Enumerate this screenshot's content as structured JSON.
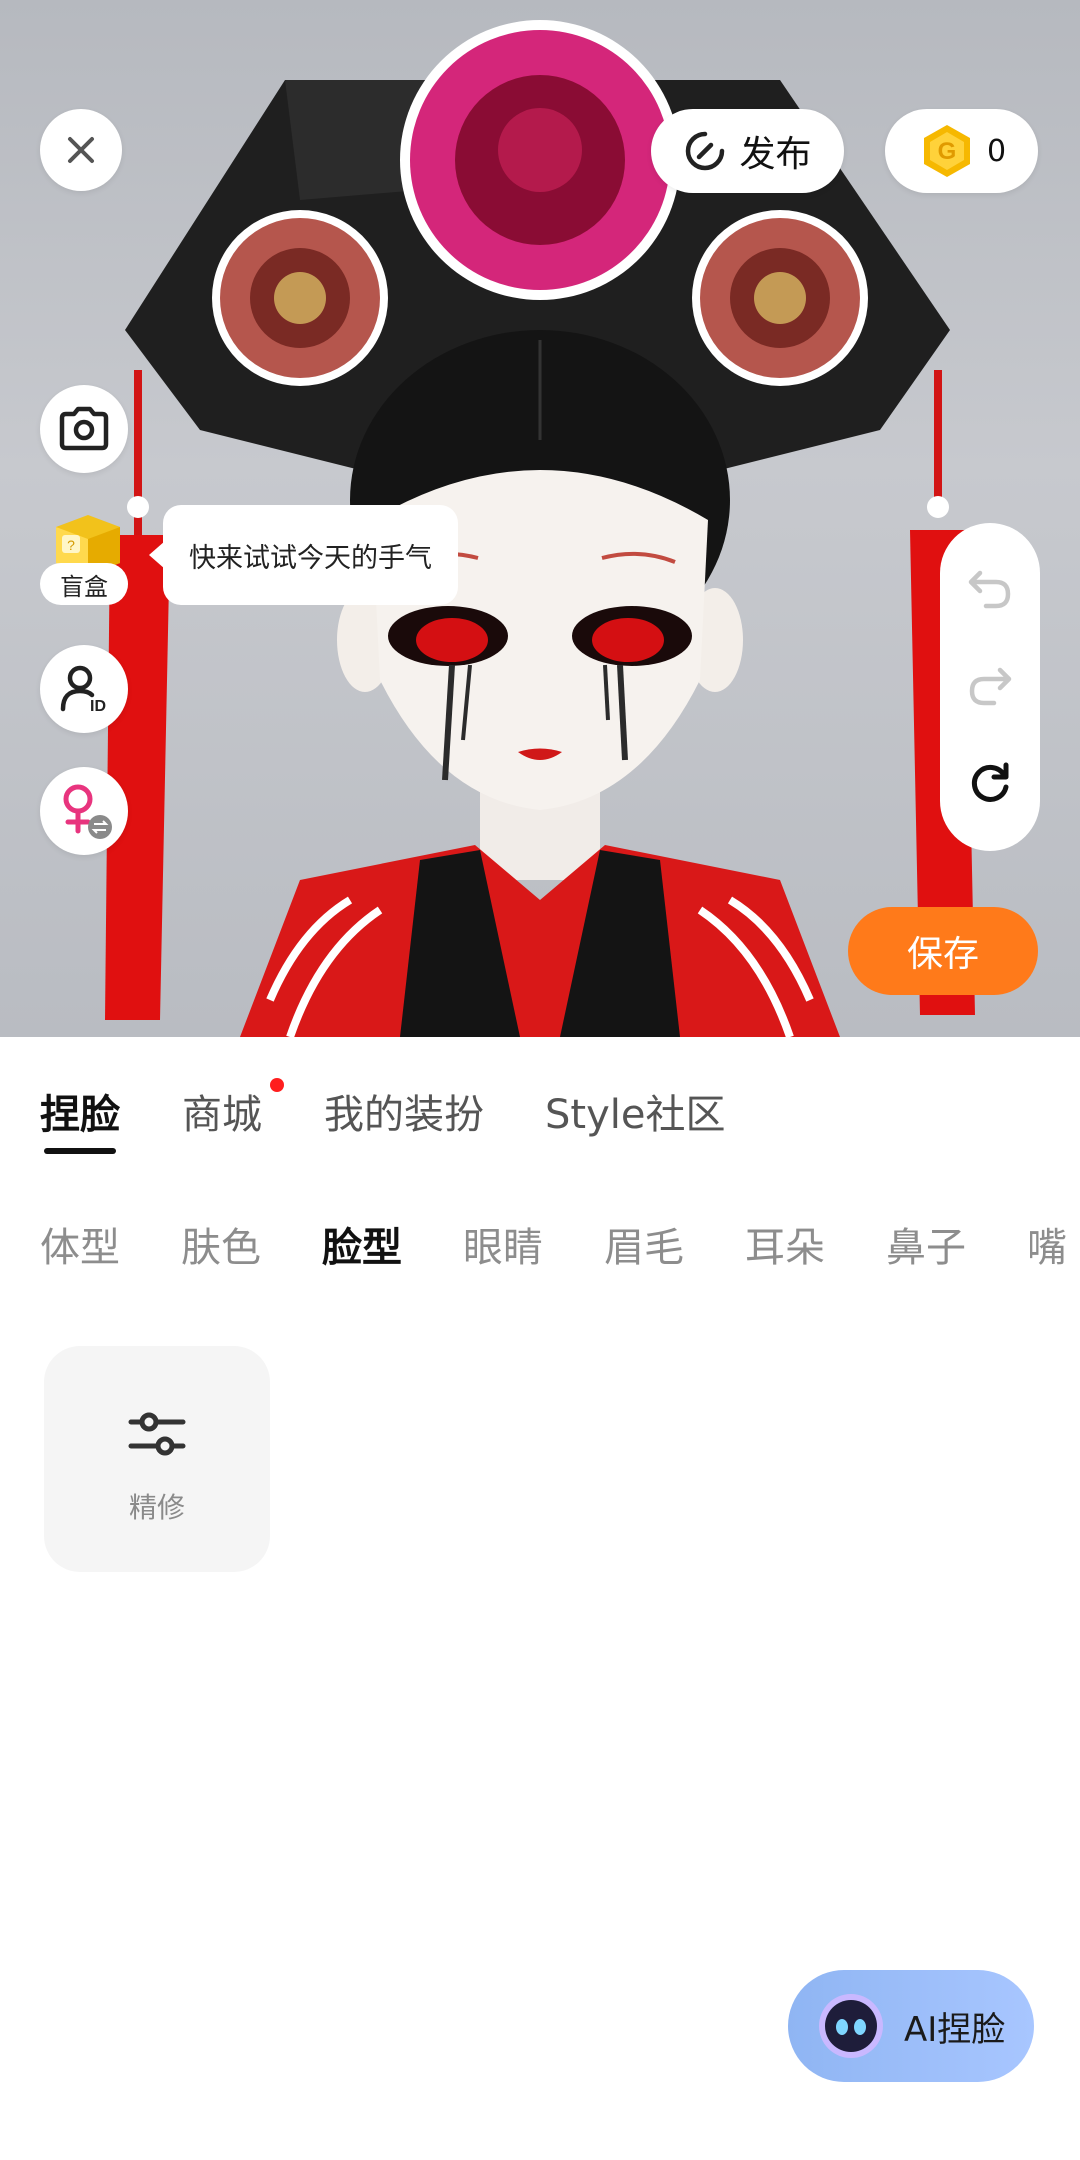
{
  "header": {
    "publish_label": "发布",
    "coin_count": "0"
  },
  "side": {
    "blindbox_label": "盲盒",
    "tip_text": "快来试试今天的手气"
  },
  "save_label": "保存",
  "main_tabs": [
    {
      "label": "捏脸",
      "active": true
    },
    {
      "label": "商城",
      "active": false,
      "dot": true
    },
    {
      "label": "我的装扮",
      "active": false
    },
    {
      "label": "Style社区",
      "active": false
    }
  ],
  "sub_tabs": [
    {
      "label": "体型"
    },
    {
      "label": "肤色"
    },
    {
      "label": "脸型",
      "active": true
    },
    {
      "label": "眼睛"
    },
    {
      "label": "眉毛"
    },
    {
      "label": "耳朵"
    },
    {
      "label": "鼻子"
    },
    {
      "label": "嘴"
    }
  ],
  "card": {
    "label": "精修"
  },
  "ai_label": "AI捏脸",
  "colors": {
    "accent_orange": "#ff7a1a",
    "badge_red": "#ff1e1e",
    "coin_gold": "#f6b800"
  }
}
